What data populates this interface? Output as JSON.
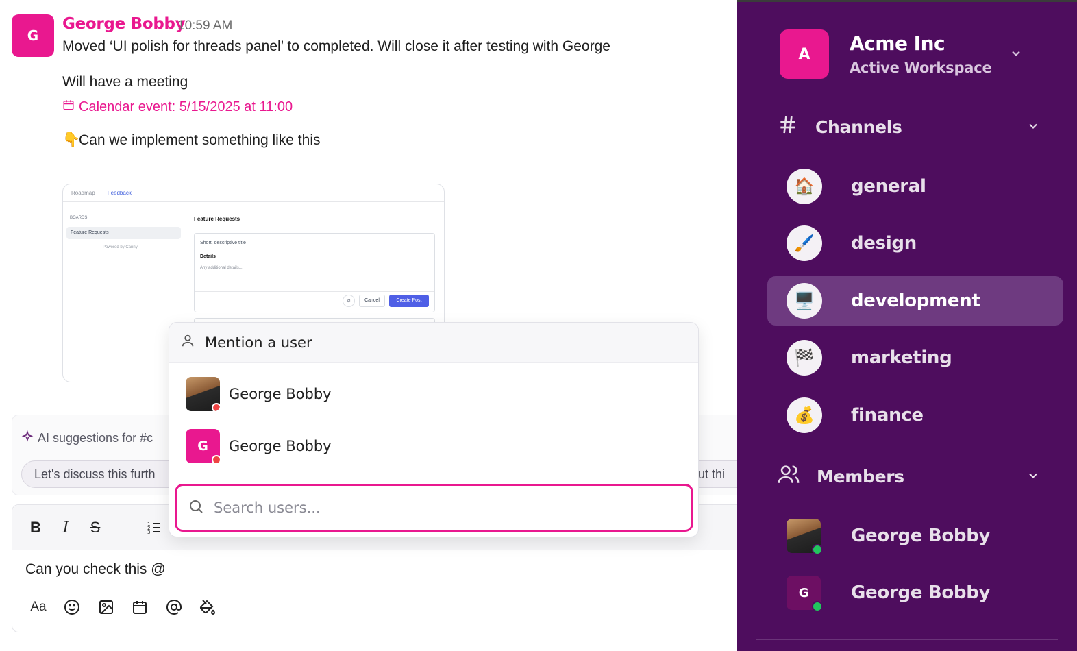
{
  "message": {
    "avatar_letter": "G",
    "author": "George Bobby",
    "time": "10:59 AM",
    "line1": "Moved ‘UI polish for threads panel’ to completed. Will close it after testing with George",
    "line2": "Will have a meeting",
    "calendar_event": "Calendar event: 5/15/2025 at 11:00",
    "line3_emoji": "👇",
    "line3": "Can we implement something like this",
    "screenshot": {
      "tab_roadmap": "Roadmap",
      "tab_feedback": "Feedback",
      "boards_label": "BOARDS",
      "board_item": "Feature Requests",
      "powered_by": "Powered by Canny",
      "title": "Feature Requests",
      "title_placeholder": "Short, descriptive title",
      "details_label": "Details",
      "details_placeholder": "Any additional details...",
      "cancel_label": "Cancel",
      "create_label": "Create Post"
    }
  },
  "ai_suggestions": {
    "title": "AI suggestions for #c",
    "chip1": "Let's discuss this furth",
    "chip2": "ut thi"
  },
  "composer": {
    "text": "Can you check this @",
    "tools": [
      "text-format-icon",
      "emoji-icon",
      "image-icon",
      "calendar-icon",
      "mention-icon",
      "paint-bucket-icon"
    ]
  },
  "mention_popup": {
    "title": "Mention a user",
    "users": [
      {
        "name": "George Bobby",
        "avatar": "photo",
        "status": "busy"
      },
      {
        "name": "George Bobby",
        "avatar_letter": "G",
        "status": "busy"
      }
    ],
    "search_placeholder": "Search users..."
  },
  "sidebar": {
    "workspace": {
      "letter": "A",
      "name": "Acme Inc",
      "subtitle": "Active Workspace"
    },
    "channels_label": "Channels",
    "channels": [
      {
        "name": "general",
        "icon": "🏠"
      },
      {
        "name": "design",
        "icon": "🖌️"
      },
      {
        "name": "development",
        "icon": "🖥️",
        "active": true
      },
      {
        "name": "marketing",
        "icon": "🏁"
      },
      {
        "name": "finance",
        "icon": "💰"
      }
    ],
    "members_label": "Members",
    "members": [
      {
        "name": "George Bobby",
        "avatar": "photo",
        "status": "online"
      },
      {
        "name": "George Bobby",
        "avatar_letter": "G",
        "status": "online"
      }
    ]
  },
  "colors": {
    "accent_pink": "#e9188f",
    "sidebar_bg": "#4e0d5e",
    "sidebar_active": "#6e3a80",
    "status_busy": "#ef4444",
    "status_online": "#22c55e"
  }
}
